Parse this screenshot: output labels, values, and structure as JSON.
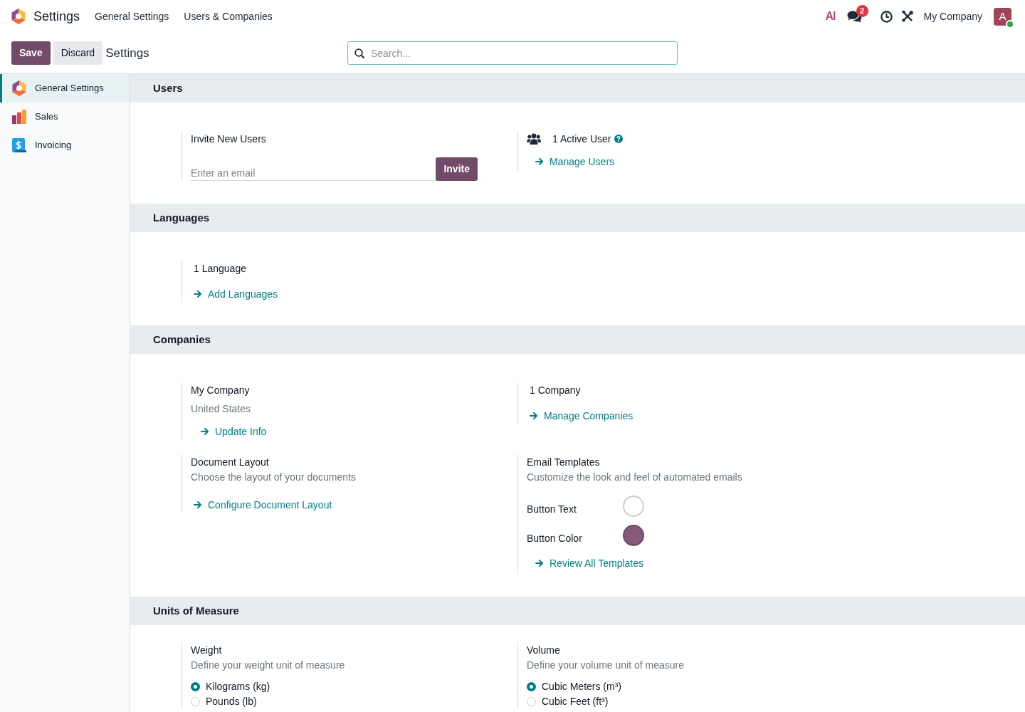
{
  "navbar": {
    "app_name": "Settings",
    "menu": [
      "General Settings",
      "Users & Companies"
    ],
    "ai_label": "AI",
    "notification_count": "2",
    "company": "My Company",
    "avatar": {
      "initial": "A",
      "online": true
    }
  },
  "control_panel": {
    "buttons": [
      {
        "label": "Save",
        "kind": "primary"
      },
      {
        "label": "Discard",
        "kind": "secondary"
      }
    ],
    "breadcrumb": "Settings",
    "search": {
      "placeholder": "Search..."
    }
  },
  "sidebar": {
    "items": [
      {
        "label": "General Settings",
        "kind": "settings",
        "selected": true
      },
      {
        "label": "Sales",
        "kind": "sales",
        "selected": false
      },
      {
        "label": "Invoicing",
        "kind": "invoicing",
        "selected": false
      }
    ]
  },
  "sections": [
    {
      "title": "Users",
      "settings": [
        {
          "kind": "invite",
          "title": "Invite New Users",
          "field": {
            "placeholder": "Enter an email"
          },
          "button": "Invite"
        },
        {
          "kind": "active_users",
          "title": "1 Active User",
          "link": "Manage Users"
        }
      ]
    },
    {
      "title": "Languages",
      "settings": [
        {
          "kind": "counter",
          "title": "1 Language",
          "link": "Add Languages"
        }
      ]
    },
    {
      "title": "Companies",
      "settings": [
        {
          "kind": "company",
          "title": "My Company",
          "description": "United States",
          "link": "Update Info"
        },
        {
          "kind": "counter",
          "title": "1 Company",
          "link": "Manage Companies"
        },
        {
          "kind": "info",
          "title": "Document Layout",
          "description": "Choose the layout of your documents",
          "link": "Configure Document Layout"
        },
        {
          "kind": "colors",
          "title": "Email Templates",
          "description": "Customize the look and feel of automated emails",
          "colors": [
            {
              "label": "Button Text",
              "color": "#ffffff"
            },
            {
              "label": "Button Color",
              "color": "#875a7b"
            }
          ],
          "link": "Review All Templates"
        }
      ]
    },
    {
      "title": "Units of Measure",
      "settings": [
        {
          "kind": "radio",
          "title": "Weight",
          "description": "Define your weight unit of measure",
          "options": [
            {
              "label": "Kilograms (kg)",
              "selected": true
            },
            {
              "label": "Pounds (lb)",
              "selected": false
            }
          ]
        },
        {
          "kind": "radio",
          "title": "Volume",
          "description": "Define your volume unit of measure",
          "options": [
            {
              "label": "Cubic Meters (m³)",
              "selected": true
            },
            {
              "label": "Cubic Feet (ft³)",
              "selected": false
            }
          ]
        }
      ]
    }
  ]
}
